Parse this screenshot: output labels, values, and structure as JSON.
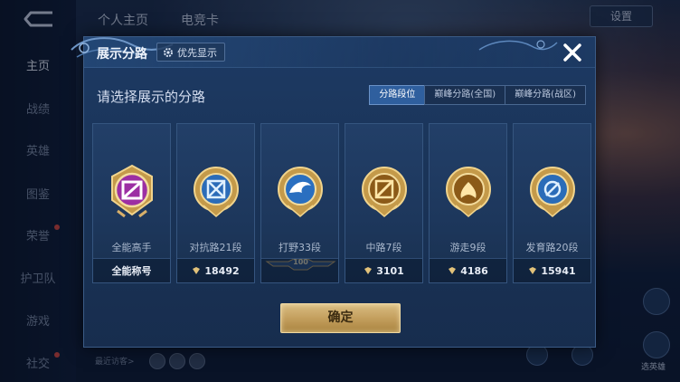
{
  "background": {
    "nav_items": [
      {
        "label": "主页",
        "active": true
      },
      {
        "label": "战绩"
      },
      {
        "label": "英雄"
      },
      {
        "label": "图鉴"
      },
      {
        "label": "荣誉"
      },
      {
        "label": "护卫队"
      },
      {
        "label": "游戏"
      },
      {
        "label": "社交"
      }
    ],
    "top_tabs": [
      "个人主页",
      "电竞卡"
    ],
    "settings_label": "设置",
    "recent_visitors": "最近访客>",
    "side_label_right": "选英雄"
  },
  "modal": {
    "title": "展示分路",
    "priority_label": "优先显示",
    "subtitle": "请选择展示的分路",
    "segments": [
      {
        "label": "分路段位",
        "active": true
      },
      {
        "label": "巅峰分路(全国)"
      },
      {
        "label": "巅峰分路(战区)"
      }
    ],
    "cards": [
      {
        "name": "全能高手",
        "foot": "全能称号",
        "has_diamond": false,
        "emblem": "allround-emblem",
        "color": "#b23fb6"
      },
      {
        "name": "对抗路21段",
        "foot": "18492",
        "has_diamond": true,
        "emblem": "clash-lane-emblem",
        "color": "#2f78c8"
      },
      {
        "name": "打野33段",
        "foot": "",
        "has_diamond": false,
        "emblem": "jungle-emblem",
        "color": "#2a6fc0",
        "badge": "100"
      },
      {
        "name": "中路7段",
        "foot": "3101",
        "has_diamond": true,
        "emblem": "mid-lane-emblem",
        "color": "#b07a28"
      },
      {
        "name": "游走9段",
        "foot": "4186",
        "has_diamond": true,
        "emblem": "roam-emblem",
        "color": "#b07a28"
      },
      {
        "name": "发育路20段",
        "foot": "15941",
        "has_diamond": true,
        "emblem": "farm-lane-emblem",
        "color": "#2f78c8"
      }
    ],
    "confirm_label": "确定"
  }
}
